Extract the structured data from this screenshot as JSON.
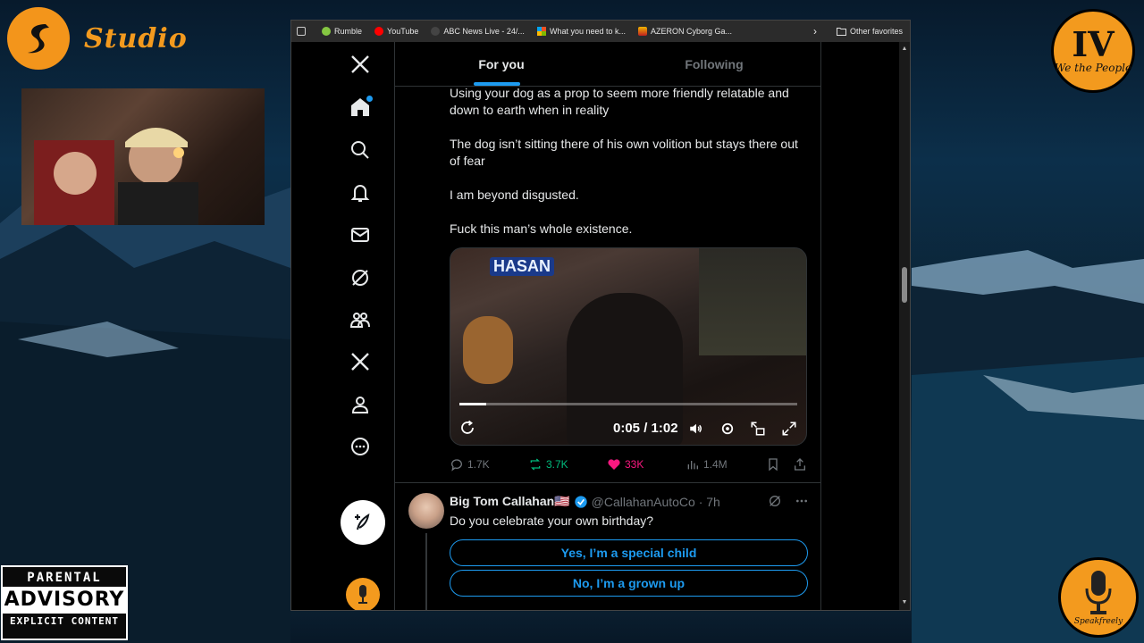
{
  "overlay": {
    "studio_text": "Studio",
    "badge_roman": "IV",
    "badge_sub": "We the People",
    "advisory": {
      "line1": "PARENTAL",
      "line2": "ADVISORY",
      "line3": "EXPLICIT CONTENT"
    },
    "mic_signature": "Speakfreely"
  },
  "favorites": {
    "items": [
      {
        "label": "Rumble",
        "color": "#85c742"
      },
      {
        "label": "YouTube",
        "color": "#ff0000"
      },
      {
        "label": "ABC News Live - 24/...",
        "color": "#444444"
      },
      {
        "label": "What you need to k...",
        "color": "#f25022"
      },
      {
        "label": "AZERON Cyborg Ga...",
        "color": "#f0b400"
      }
    ],
    "other": "Other favorites"
  },
  "tabs": {
    "for_you": "For you",
    "following": "Following"
  },
  "tweet1": {
    "para1": "Using your dog as a prop to seem more friendly relatable and down to earth when in reality",
    "para2": "The dog isn’t sitting there of his own volition but stays there out of fear",
    "para3": "I am beyond disgusted.",
    "para4": "Fuck this man’s whole existence.",
    "video": {
      "banner": "HASAN",
      "time": "0:05 / 1:02",
      "progress": 0.08
    },
    "stats": {
      "replies": "1.7K",
      "reposts": "3.7K",
      "likes": "33K",
      "views": "1.4M"
    }
  },
  "tweet2": {
    "name": "Big Tom Callahan🇺🇸",
    "handle": "@CallahanAutoCo · 7h",
    "text": "Do you celebrate your own birthday?",
    "poll": [
      "Yes, I’m a special child",
      "No, I’m a grown up"
    ]
  }
}
